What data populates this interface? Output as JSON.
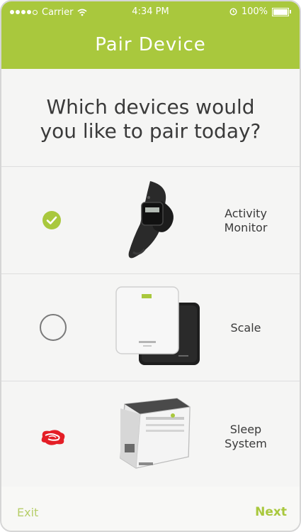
{
  "status_bar": {
    "carrier": "Carrier",
    "time": "4:34 PM",
    "battery": "100%"
  },
  "header": {
    "title": "Pair Device"
  },
  "prompt": {
    "line1": "Which devices would",
    "line2": "you like to pair today?"
  },
  "devices": [
    {
      "label_line1": "Activity",
      "label_line2": "Monitor",
      "selected": true,
      "icon": "activity-tracker-band"
    },
    {
      "label_line1": "Scale",
      "label_line2": "",
      "selected": false,
      "icon": "smart-scale"
    },
    {
      "label_line1": "Sleep",
      "label_line2": "System",
      "selected": false,
      "icon": "sleep-system-device"
    }
  ],
  "footer": {
    "exit_label": "Exit",
    "next_label": "Next"
  },
  "colors": {
    "accent": "#a9c83d",
    "text": "#3a3a3a",
    "divider": "#dedede",
    "error_red": "#e41e26"
  }
}
